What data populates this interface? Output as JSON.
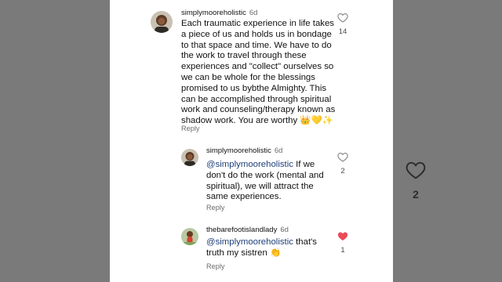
{
  "comments": [
    {
      "username": "simplymooreholistic",
      "time": "6d",
      "text": "Each traumatic experience in life takes a piece of us and holds us in bondage to that space and time. We have to do the work to travel through these experiences and \"collect\" ourselves so we can be whole for the blessings promised to us bybthe Almighty. This can be accomplished through spiritual work and counseling/therapy known as shadow work. You are worthy 👑💛✨",
      "reply_label": "Reply",
      "likes": "14",
      "liked": false
    },
    {
      "username": "simplymooreholistic",
      "time": "6d",
      "mention": "@simplymooreholistic",
      "text": " If we don't do the work (mental and spiritual), we will attract the same experiences.",
      "reply_label": "Reply",
      "likes": "2",
      "liked": false
    },
    {
      "username": "thebarefootislandlady",
      "time": "6d",
      "mention": "@simplymooreholistic",
      "text": " that's truth my sistren 👏",
      "reply_label": "Reply",
      "likes": "1",
      "liked": true
    }
  ],
  "video_overlay": {
    "like_count": "2",
    "icon": "heart-outline-icon"
  },
  "colors": {
    "liked_heart": "#ed4956",
    "mention": "#21417a",
    "background": "#7a7a7a"
  }
}
